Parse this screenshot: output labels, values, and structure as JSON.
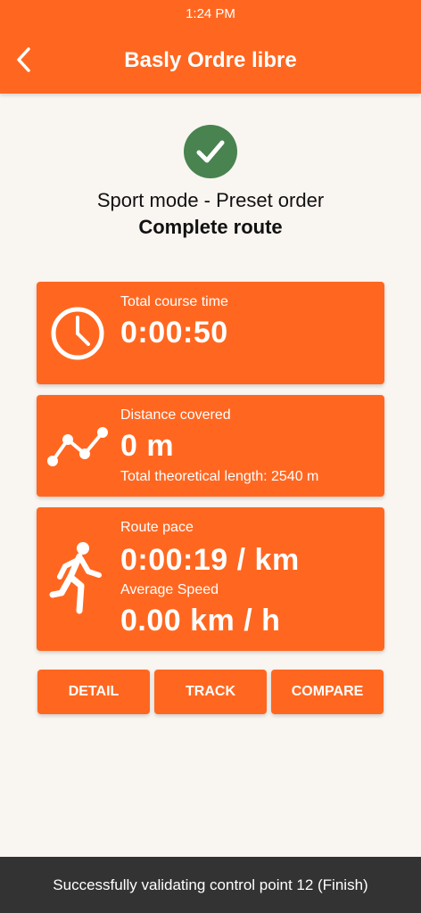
{
  "status_bar": {
    "time": "1:24 PM"
  },
  "header": {
    "title": "Basly Ordre libre",
    "back_icon": "chevron-left-icon"
  },
  "result": {
    "icon": "check-circle-icon",
    "mode": "Sport mode - Preset order",
    "route_status": "Complete route"
  },
  "cards": {
    "time": {
      "icon": "clock-icon",
      "label": "Total course time",
      "value": "0:00:50"
    },
    "distance": {
      "icon": "route-line-icon",
      "label": "Distance covered",
      "value": "0 m",
      "sub": "Total theoretical length: 2540  m"
    },
    "pace": {
      "icon": "runner-icon",
      "label": "Route pace",
      "value": "0:00:19 / km",
      "speed_label": "Average Speed",
      "speed_value": "0.00 km / h"
    }
  },
  "buttons": {
    "detail": "DETAIL",
    "track": "TRACK",
    "compare": "COMPARE"
  },
  "toast": {
    "message": "Successfully validating control point 12 (Finish)"
  },
  "colors": {
    "accent": "#ff6720",
    "success": "#498350",
    "background": "#f9f5f1",
    "toast": "#333333"
  }
}
